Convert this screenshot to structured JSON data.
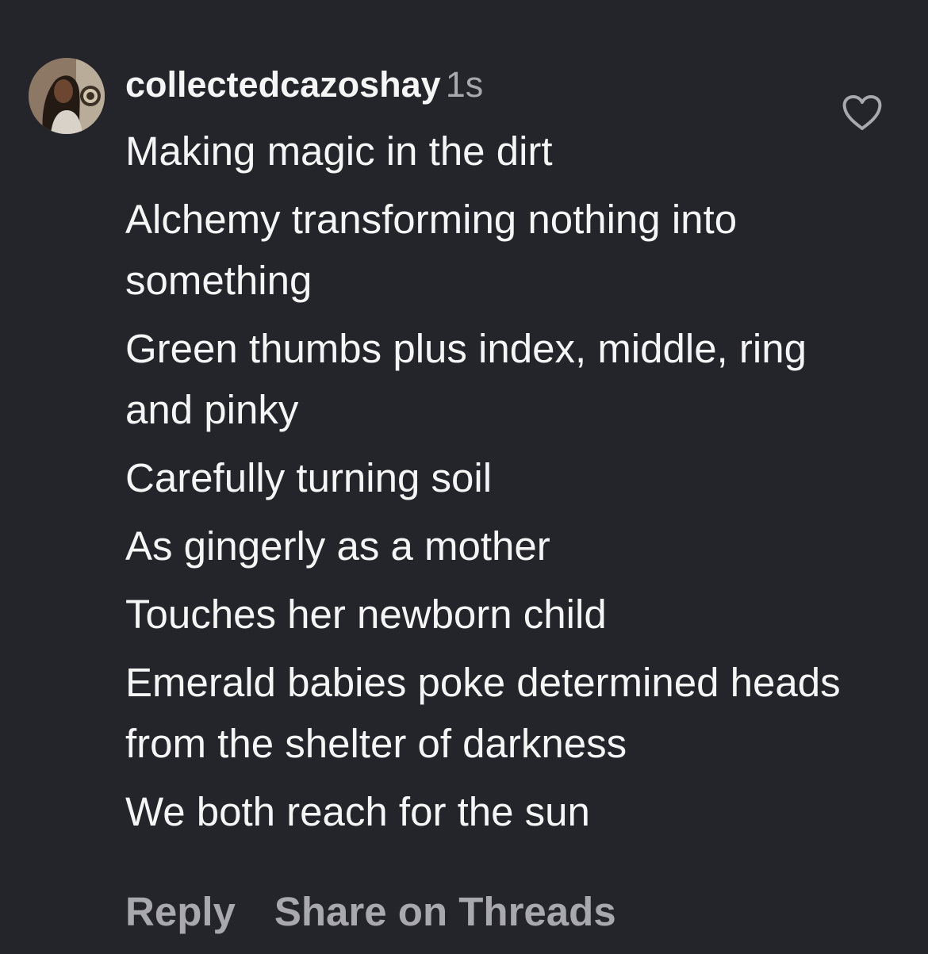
{
  "comment": {
    "avatar_icon": "user-avatar-photo",
    "username": "collectedcazoshay",
    "timestamp": "1s",
    "like_icon": "heart-outline-icon",
    "lines": [
      "Making magic in the dirt",
      "Alchemy transforming nothing into something",
      "Green thumbs plus index, middle, ring and pinky",
      "Carefully turning soil",
      "As gingerly as a mother",
      "Touches her newborn child",
      "Emerald babies poke determined heads from the shelter of darkness",
      "We both reach for the sun"
    ],
    "actions": {
      "reply": "Reply",
      "share": "Share on Threads"
    }
  },
  "colors": {
    "background": "#24252a",
    "text": "#f5f5f5",
    "muted": "#a8a8ad"
  }
}
